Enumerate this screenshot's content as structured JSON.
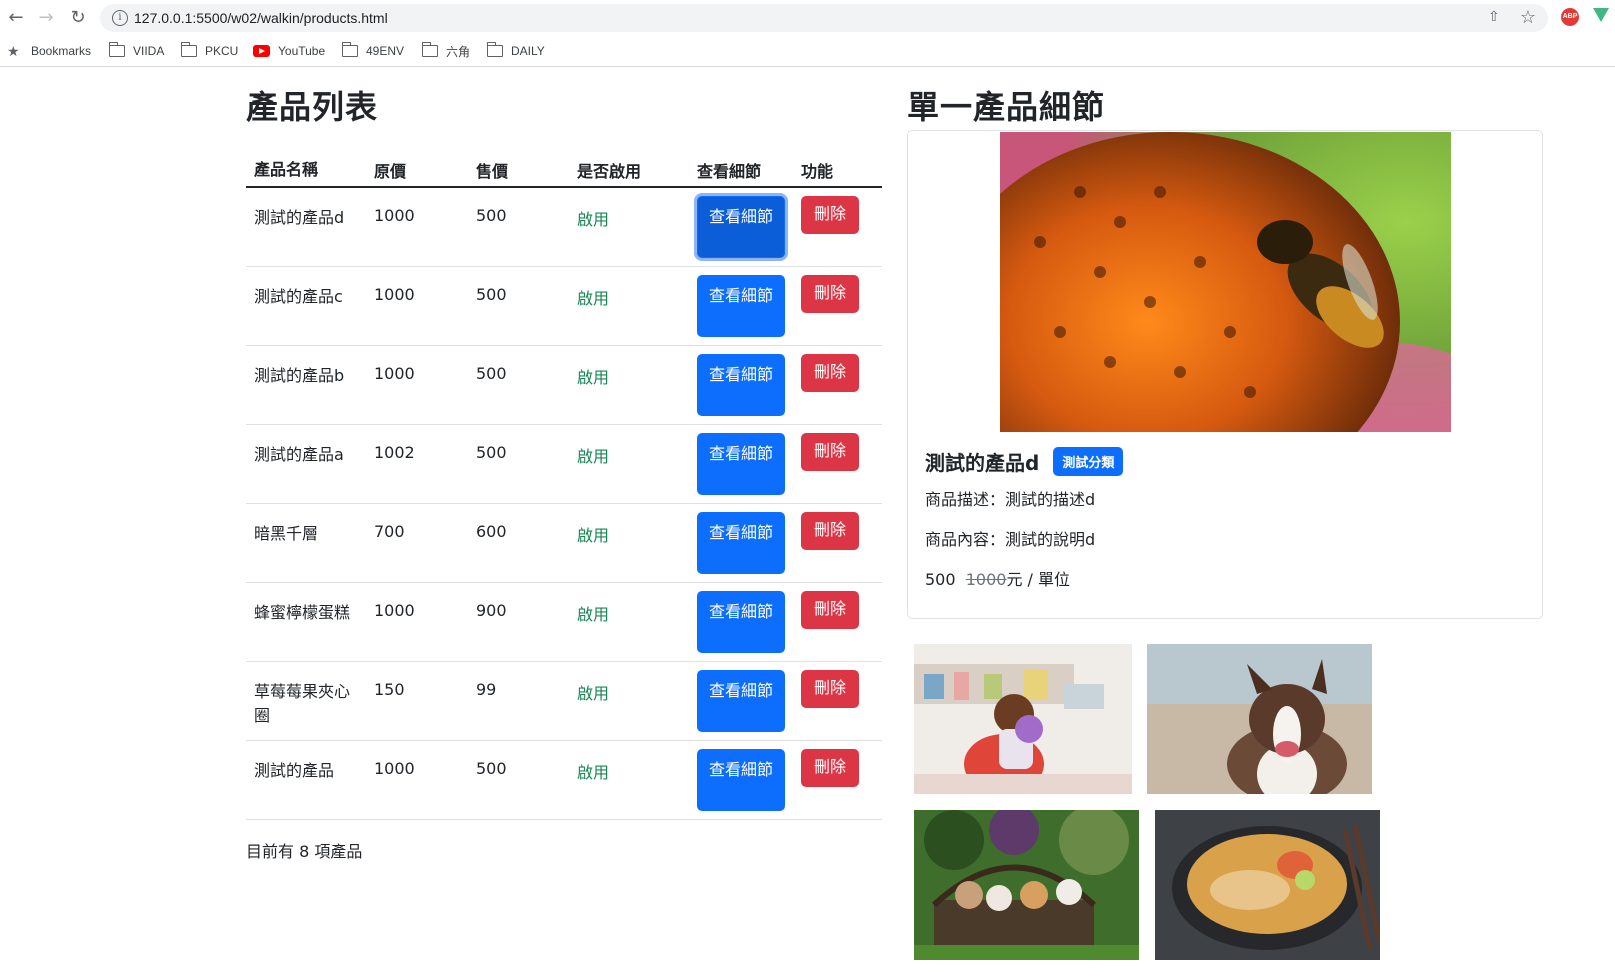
{
  "browser": {
    "url": "127.0.0.1:5500/w02/walkin/products.html",
    "bookmarks": [
      {
        "label": "Bookmarks",
        "icon": "star-icon"
      },
      {
        "label": "VIIDA",
        "icon": "folder-icon"
      },
      {
        "label": "PKCU",
        "icon": "folder-icon"
      },
      {
        "label": "YouTube",
        "icon": "youtube-icon"
      },
      {
        "label": "49ENV",
        "icon": "folder-icon"
      },
      {
        "label": "六角",
        "icon": "folder-icon"
      },
      {
        "label": "DAILY",
        "icon": "folder-icon"
      }
    ],
    "extensions": {
      "abp": "ABP"
    }
  },
  "list": {
    "title": "產品列表",
    "headers": {
      "name": "產品名稱",
      "orig": "原價",
      "price": "售價",
      "enabled": "是否啟用",
      "detail": "查看細節",
      "func": "功能"
    },
    "rows": [
      {
        "name": "測試的產品d",
        "orig": "1000",
        "price": "500",
        "enabled": "啟用",
        "detail": "查看細節",
        "del": "刪除"
      },
      {
        "name": "測試的產品c",
        "orig": "1000",
        "price": "500",
        "enabled": "啟用",
        "detail": "查看細節",
        "del": "刪除"
      },
      {
        "name": "測試的產品b",
        "orig": "1000",
        "price": "500",
        "enabled": "啟用",
        "detail": "查看細節",
        "del": "刪除"
      },
      {
        "name": "測試的產品a",
        "orig": "1002",
        "price": "500",
        "enabled": "啟用",
        "detail": "查看細節",
        "del": "刪除"
      },
      {
        "name": "暗黑千層",
        "orig": "700",
        "price": "600",
        "enabled": "啟用",
        "detail": "查看細節",
        "del": "刪除"
      },
      {
        "name": "蜂蜜檸檬蛋糕",
        "orig": "1000",
        "price": "900",
        "enabled": "啟用",
        "detail": "查看細節",
        "del": "刪除"
      },
      {
        "name": "草莓莓果夾心圈",
        "orig": "150",
        "price": "99",
        "enabled": "啟用",
        "detail": "查看細節",
        "del": "刪除"
      },
      {
        "name": "測試的產品",
        "orig": "1000",
        "price": "500",
        "enabled": "啟用",
        "detail": "查看細節",
        "del": "刪除"
      }
    ],
    "count_text": "目前有 8 項產品"
  },
  "detail": {
    "title": "單一產品細節",
    "product_name": "測試的產品d",
    "category": "測試分類",
    "description": "商品描述：測試的描述d",
    "content": "商品內容：測試的說明d",
    "price": "500",
    "orig_price": "1000",
    "unit_text": "元 / 單位"
  },
  "colors": {
    "primary": "#0d6efd",
    "danger": "#dc3545",
    "success": "#198754"
  }
}
